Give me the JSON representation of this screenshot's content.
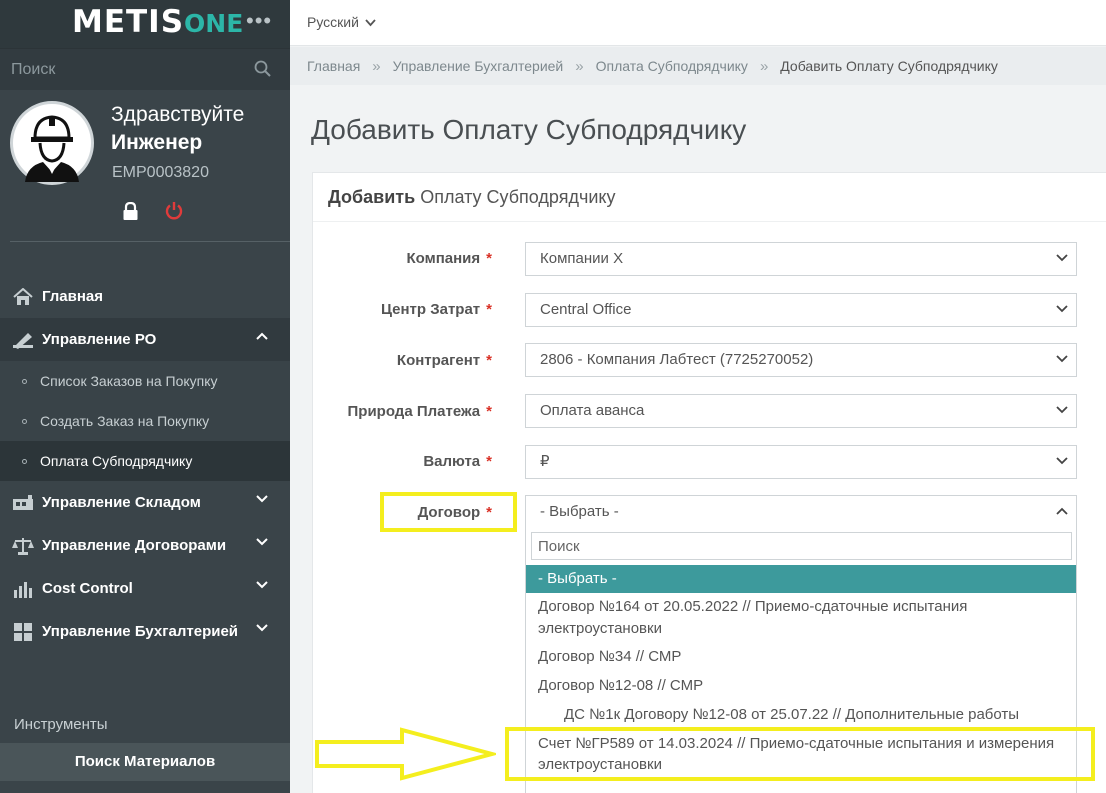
{
  "sidebar": {
    "logo_main": "METIS",
    "logo_suffix": "ONE",
    "search_placeholder": "Поиск",
    "greeting": "Здравствуйте",
    "user_name": "Инженер",
    "employee_id": "EMP0003820",
    "menu": {
      "home": "Главная",
      "po": "Управление РО",
      "po_sub": [
        "Список Заказов на Покупку",
        "Создать Заказ на Покупку",
        "Оплата Субподрядчику"
      ],
      "warehouse": "Управление Складом",
      "contracts": "Управление Договорами",
      "cost": "Cost Control",
      "accounting": "Управление Бухгалтерией"
    },
    "tools_title": "Инструменты",
    "tools_button": "Поиск Материалов"
  },
  "topbar": {
    "language": "Русский"
  },
  "breadcrumb": [
    "Главная",
    "Управление Бухгалтерией",
    "Оплата Субподрядчику",
    "Добавить Оплату Субподрядчику"
  ],
  "page_title": "Добавить Оплату Субподрядчику",
  "card": {
    "title_bold": "Добавить",
    "title_rest": "Оплату Субподрядчику"
  },
  "form": {
    "company": {
      "label": "Компания",
      "value": "Компании X"
    },
    "cost_center": {
      "label": "Центр Затрат",
      "value": "Central Office"
    },
    "counterparty": {
      "label": "Контрагент",
      "value": "2806 - Компания Лабтест (7725270052)"
    },
    "payment_nature": {
      "label": "Природа Платежа",
      "value": "Оплата аванса"
    },
    "currency": {
      "label": "Валюта",
      "value": "₽"
    },
    "contract": {
      "label": "Договор",
      "value": "- Выбрать -"
    },
    "required_mark": "*"
  },
  "dropdown": {
    "search_placeholder": "Поиск",
    "options": [
      "- Выбрать -",
      "Договор №164 от 20.05.2022 // Приемо-сдаточные испытания",
      "электроустановки",
      "Договор №34 // СМР",
      "Договор №12-08 // СМР",
      "ДС №1к Договору №12-08 от 25.07.22 // Дополнительные работы",
      "Счет №ГР589 от 14.03.2024 // Приемо-сдаточные испытания и измерения",
      "электроустановки"
    ]
  },
  "colors": {
    "sidebar_bg": "#3a4449",
    "accent_teal": "#3d9a9c",
    "highlight_yellow": "#f4ee1e",
    "required_red": "#d93025"
  }
}
